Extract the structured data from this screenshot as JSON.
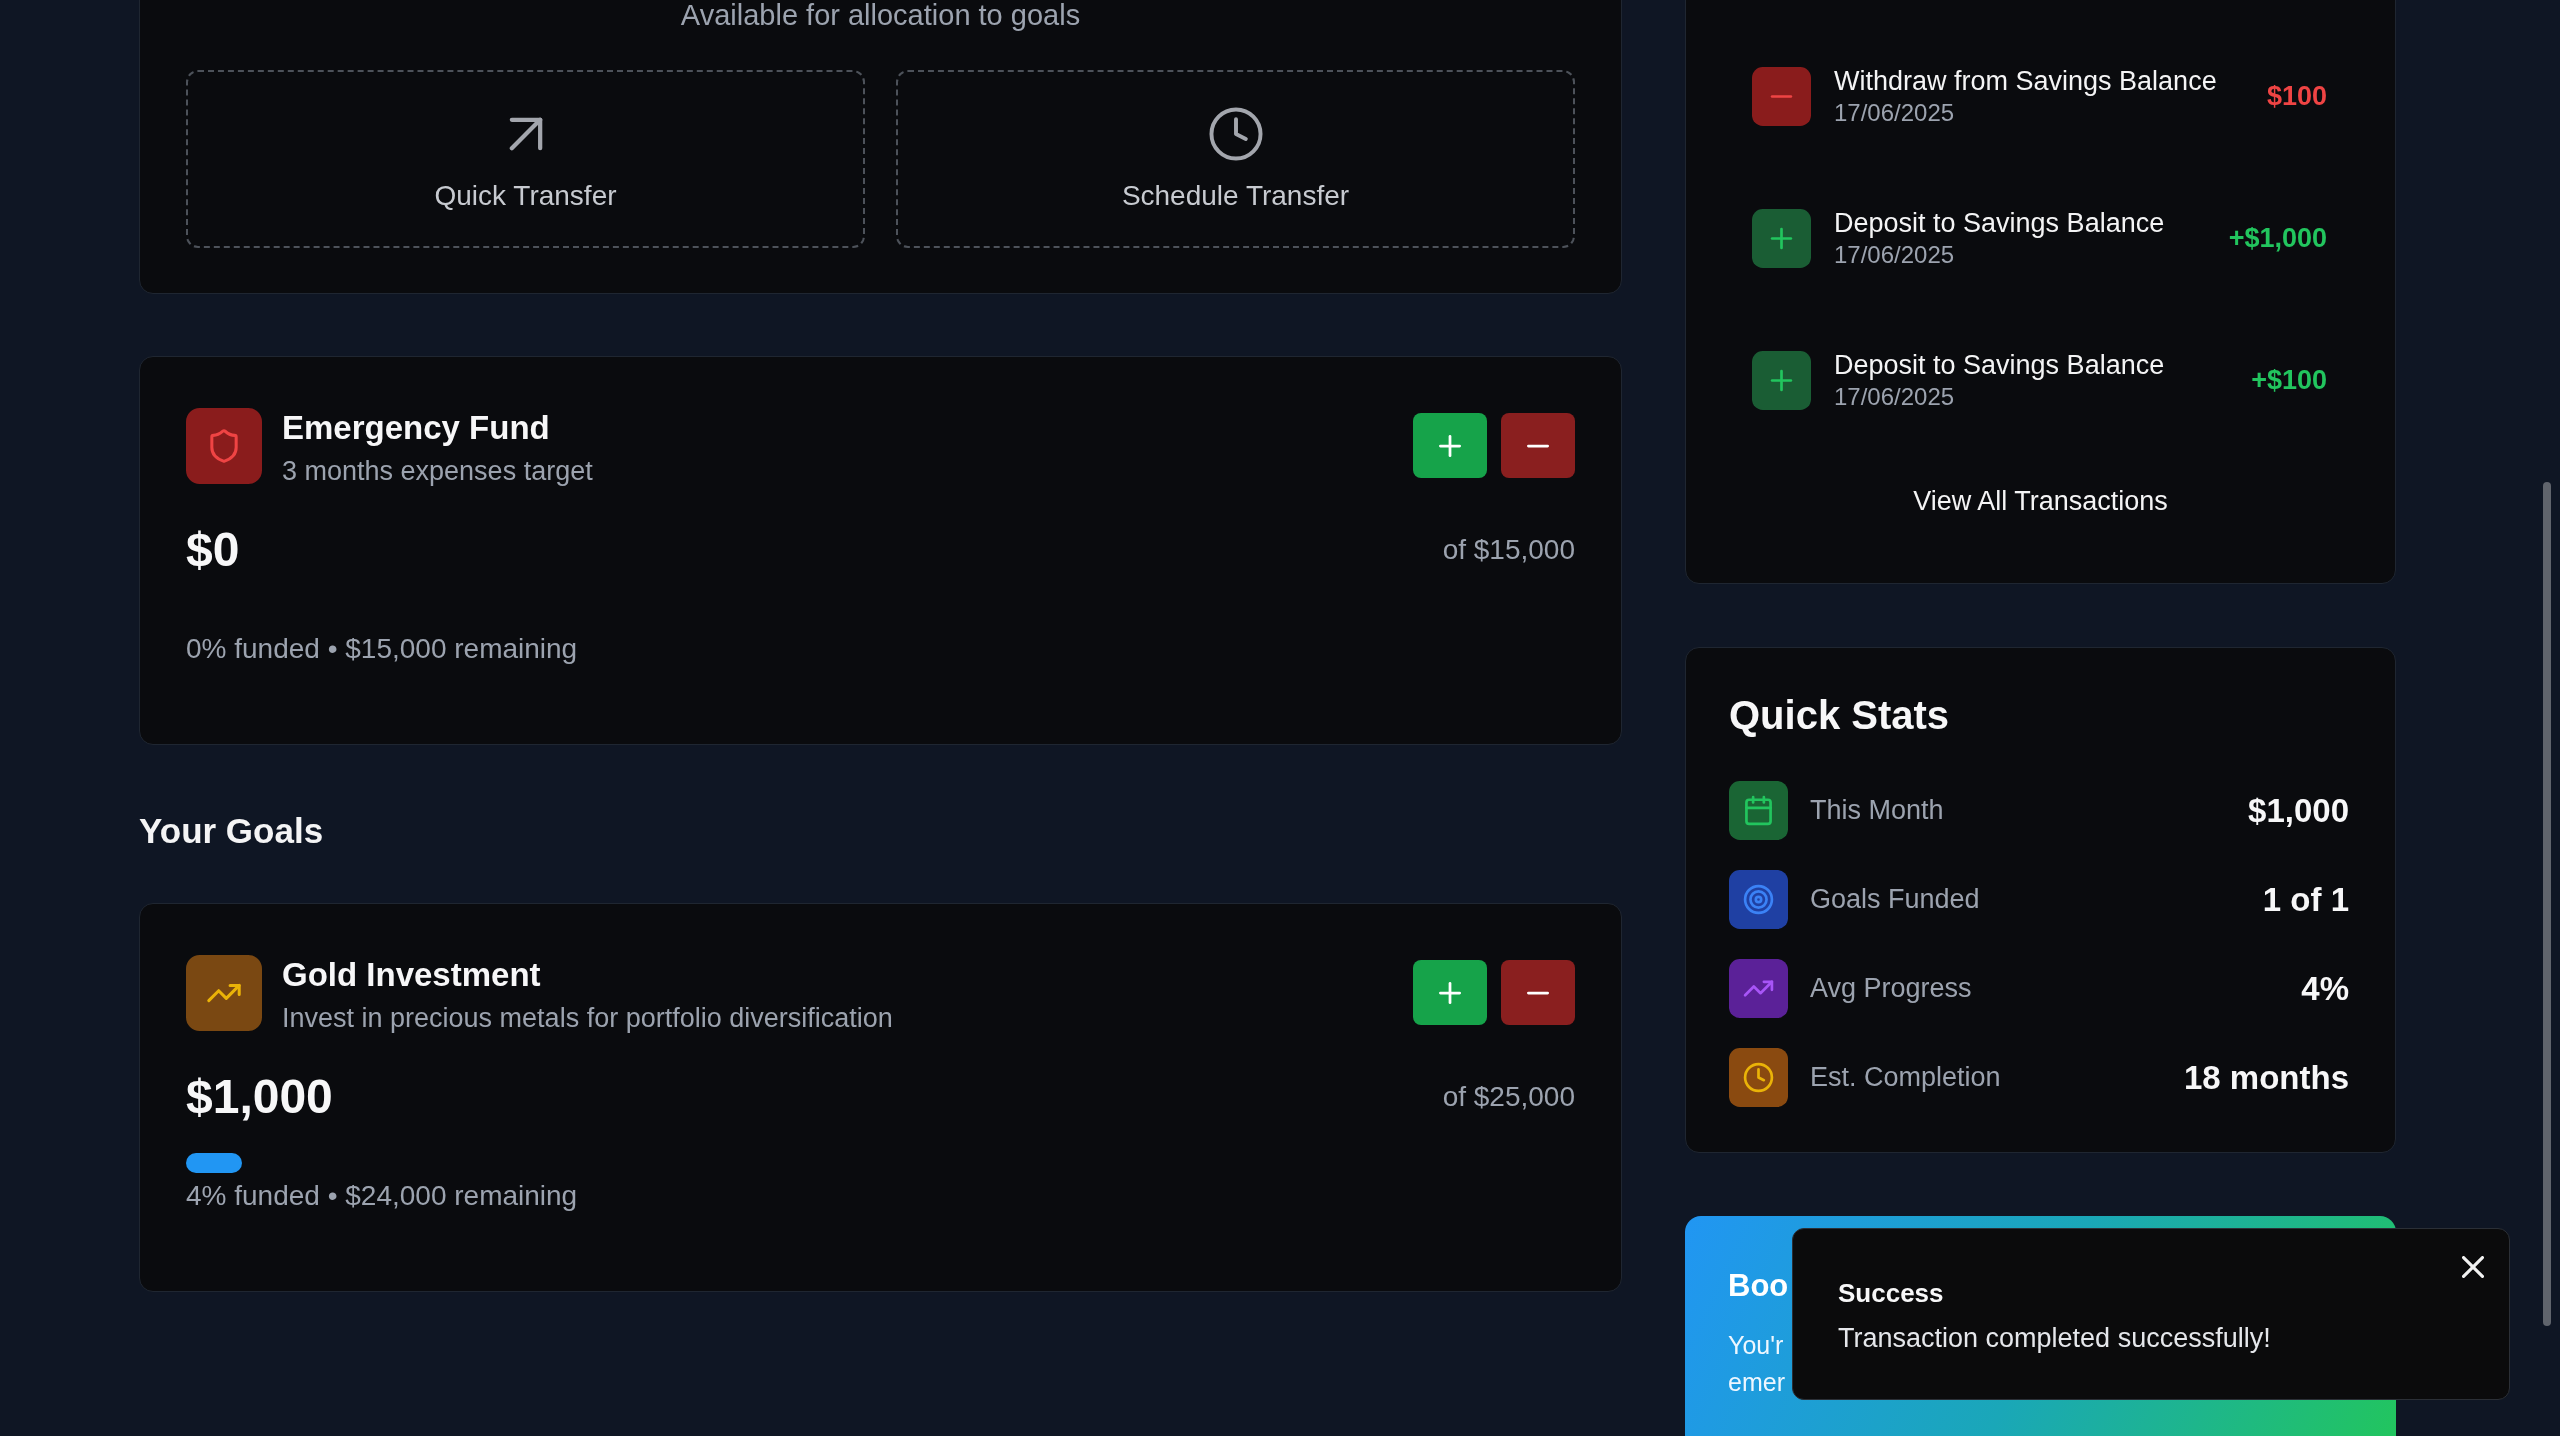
{
  "allocation": {
    "caption": "Available for allocation to goals",
    "actions": [
      {
        "label": "Quick Transfer"
      },
      {
        "label": "Schedule Transfer"
      }
    ]
  },
  "emergency_fund": {
    "title": "Emergency Fund",
    "description": "3 months expenses target",
    "amount": "$0",
    "target": "of $15,000",
    "summary": "0% funded • $15,000 remaining"
  },
  "goals_heading": "Your Goals",
  "goals": [
    {
      "title": "Gold Investment",
      "description": "Invest in precious metals for portfolio diversification",
      "amount": "$1,000",
      "target": "of $25,000",
      "level": 0.04,
      "summary": "4% funded • $24,000 remaining"
    }
  ],
  "transactions": {
    "items": [
      {
        "kind": "withdrawal",
        "title": "Withdraw from Savings Balance",
        "date": "17/06/2025",
        "amount": "$100"
      },
      {
        "kind": "deposit",
        "title": "Deposit to Savings Balance",
        "date": "17/06/2025",
        "amount": "+$1,000"
      },
      {
        "kind": "deposit",
        "title": "Deposit to Savings Balance",
        "date": "17/06/2025",
        "amount": "+$100"
      }
    ],
    "view_all": "View All Transactions"
  },
  "quick_stats": {
    "title": "Quick Stats",
    "items": [
      {
        "label": "This Month",
        "value": "$1,000"
      },
      {
        "label": "Goals Funded",
        "value": "1 of 1"
      },
      {
        "label": "Avg Progress",
        "value": "4%"
      },
      {
        "label": "Est. Completion",
        "value": "18 months"
      }
    ]
  },
  "promo": {
    "title": "Boo",
    "lines": [
      "You'r",
      "emer"
    ]
  },
  "toast": {
    "title": "Success",
    "message": "Transaction completed successfully!"
  }
}
